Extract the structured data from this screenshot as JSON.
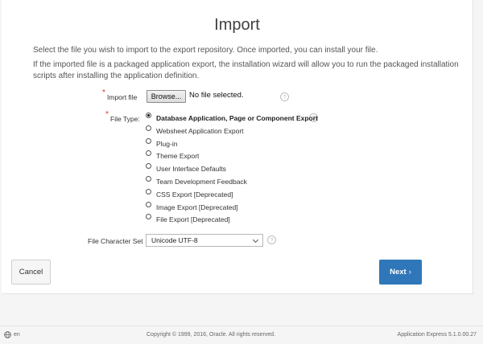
{
  "dialog": {
    "title": "Import",
    "intro_1": "Select the file you wish to import to the export repository. Once imported, you can install your file.",
    "intro_2": "If the imported file is a packaged application export, the installation wizard will allow you to run the packaged installation scripts after installing the application definition."
  },
  "import_file": {
    "required_mark": "*",
    "label": "Import file",
    "browse_label": "Browse...",
    "status": "No file selected.",
    "help": "?"
  },
  "file_type": {
    "required_mark": "*",
    "label": "File Type:",
    "help": "?",
    "options": [
      {
        "label": "Database Application, Page or Component Export",
        "checked": true
      },
      {
        "label": "Websheet Application Export",
        "checked": false
      },
      {
        "label": "Plug-in",
        "checked": false
      },
      {
        "label": "Theme Export",
        "checked": false
      },
      {
        "label": "User Interface Defaults",
        "checked": false
      },
      {
        "label": "Team Development Feedback",
        "checked": false
      },
      {
        "label": "CSS Export [Deprecated]",
        "checked": false
      },
      {
        "label": "Image Export [Deprecated]",
        "checked": false
      },
      {
        "label": "File Export [Deprecated]",
        "checked": false
      }
    ]
  },
  "charset": {
    "label": "File Character Set",
    "selected": "Unicode UTF-8",
    "help": "?"
  },
  "buttons": {
    "cancel": "Cancel",
    "next": "Next",
    "next_icon": "chevron-right-icon"
  },
  "footer": {
    "language": "en",
    "language_icon": "globe-icon",
    "copyright": "Copyright © 1999, 2016, Oracle. All rights reserved.",
    "version": "Application Express 5.1.0.00.27"
  },
  "colors": {
    "accent": "#2f77b9",
    "required": "#e0312a"
  }
}
